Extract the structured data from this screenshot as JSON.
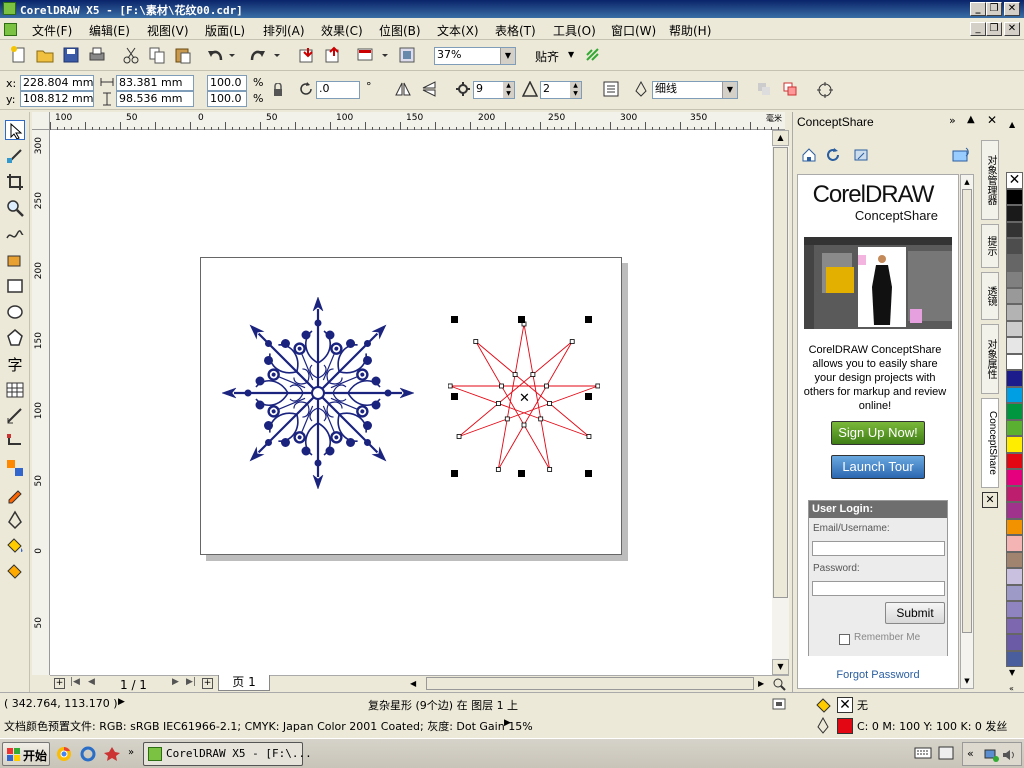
{
  "window": {
    "title": "CorelDRAW X5 - [F:\\素材\\花纹00.cdr]",
    "min": "_",
    "max": "❐",
    "close": "✕"
  },
  "menu": [
    "文件(F)",
    "编辑(E)",
    "视图(V)",
    "版面(L)",
    "排列(A)",
    "效果(C)",
    "位图(B)",
    "文本(X)",
    "表格(T)",
    "工具(O)",
    "窗口(W)",
    "帮助(H)"
  ],
  "toolbar": {
    "zoom": "37%",
    "snap_label": "贴齐"
  },
  "propbar": {
    "x_label": "x:",
    "y_label": "y:",
    "x": "228.804 mm",
    "y": "108.812 mm",
    "w": "83.381 mm",
    "h": "98.536 mm",
    "scale_w": "100.0",
    "scale_h": "100.0",
    "pct": "%",
    "angle": ".0",
    "deg": "°",
    "points": "9",
    "sharpness": "2",
    "outline": "细线"
  },
  "rulers": {
    "h_ticks": [
      "100",
      "50",
      "0",
      "50",
      "100",
      "150",
      "200",
      "250",
      "300",
      "350"
    ],
    "h_unit": "毫米",
    "v_ticks": [
      "300",
      "250",
      "200",
      "150",
      "100",
      "50",
      "0",
      "50"
    ]
  },
  "pager": {
    "page_count": "1 / 1",
    "page_tab": "页 1"
  },
  "docker": {
    "title": "ConceptShare",
    "logo_main": "CorelDRAW",
    "logo_sub": "ConceptShare",
    "description": "CorelDRAW ConceptShare allows you to easily share your design projects with others for markup and review online!",
    "signup": "Sign Up Now!",
    "tour": "Launch Tour",
    "login_title": "User Login:",
    "email_label": "Email/Username:",
    "email_value": "",
    "password_label": "Password:",
    "password_value": "",
    "submit": "Submit",
    "remember": "Remember Me",
    "forgot": "Forgot Password"
  },
  "side_tabs": [
    "对象管理器",
    "提示",
    "透镜",
    "对象属性",
    "ConceptShare"
  ],
  "palette": {
    "colors": [
      "#ffffff",
      "#000000",
      "#1a1a1a",
      "#333333",
      "#4d4d4d",
      "#666666",
      "#808080",
      "#999999",
      "#b3b3b3",
      "#cccccc",
      "#e6e6e6",
      "#ffffff",
      "#1c1c8c",
      "#009fe3",
      "#009640",
      "#5ab031",
      "#ffed00",
      "#e30613",
      "#e5007e",
      "#be1e6e",
      "#a0338c",
      "#f39200",
      "#f4b4b4",
      "#a08470",
      "#c9c0e0",
      "#9e9ac8",
      "#8f83c0",
      "#7d68b0",
      "#6b5aa6",
      "#4a5e9e"
    ]
  },
  "status": {
    "coords": "( 342.764, 113.170 )",
    "selection": "复杂星形 (9个边) 在 图层 1 上",
    "fill_none": "无",
    "profile": "文档颜色预置文件: RGB: sRGB IEC61966-2.1; CMYK: Japan Color 2001 Coated; 灰度: Dot Gain 15%",
    "outline_info": "C: 0 M: 100 Y: 100 K: 0  发丝",
    "fill_color": "#1a237e",
    "outline_color": "#e30613"
  },
  "taskbar": {
    "start": "开始",
    "task": "CorelDRAW X5 - [F:\\..."
  }
}
